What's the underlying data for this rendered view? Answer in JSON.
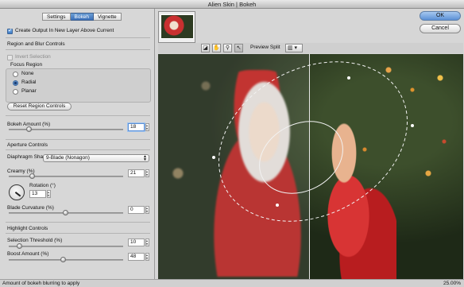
{
  "window": {
    "title": "Alien Skin | Bokeh"
  },
  "tabs": [
    {
      "label": "Settings",
      "active": false
    },
    {
      "label": "Bokeh",
      "active": true
    },
    {
      "label": "Vignette",
      "active": false
    }
  ],
  "options": {
    "create_output_label": "Create Output In New Layer Above Current",
    "create_output_checked": true
  },
  "region": {
    "header": "Region and Blur Controls",
    "invert_label": "Invert Selection",
    "invert_checked": false,
    "focus_region_label": "Focus Region",
    "focus_options": [
      "None",
      "Radial",
      "Planar"
    ],
    "focus_selected": "Radial",
    "reset_label": "Reset Region Controls"
  },
  "bokeh_amount": {
    "label": "Bokeh Amount (%)",
    "value": "18",
    "level": 0.18
  },
  "aperture": {
    "header": "Aperture Controls",
    "shape_label": "Diaphragm Shape",
    "shape_value": "9-Blade (Nonagon)",
    "creamy_label": "Creamy (%)",
    "creamy_value": "21",
    "creamy_level": 0.21,
    "rotation_label": "Rotation (°)",
    "rotation_value": "13",
    "blade_label": "Blade Curvature (%)",
    "blade_value": "0",
    "blade_level": 0.5
  },
  "highlight": {
    "header": "Highlight Controls",
    "threshold_label": "Selection Threshold (%)",
    "threshold_value": "10",
    "threshold_level": 0.1,
    "boost_label": "Boost Amount (%)",
    "boost_value": "48",
    "boost_level": 0.48
  },
  "toolbar": {
    "preview_split_label": "Preview Split"
  },
  "icons": {
    "tool1": "compare-icon",
    "tool2": "hand-icon",
    "tool3": "zoom-icon",
    "tool4": "pointer-icon",
    "split": "split-view-icon"
  },
  "dialog": {
    "ok_label": "OK",
    "cancel_label": "Cancel"
  },
  "status": {
    "message": "Amount of bokeh blurring to apply",
    "zoom": "25.00%"
  },
  "colors": {
    "accent": "#5b90d6",
    "active_tab": "#3b6fb8"
  }
}
